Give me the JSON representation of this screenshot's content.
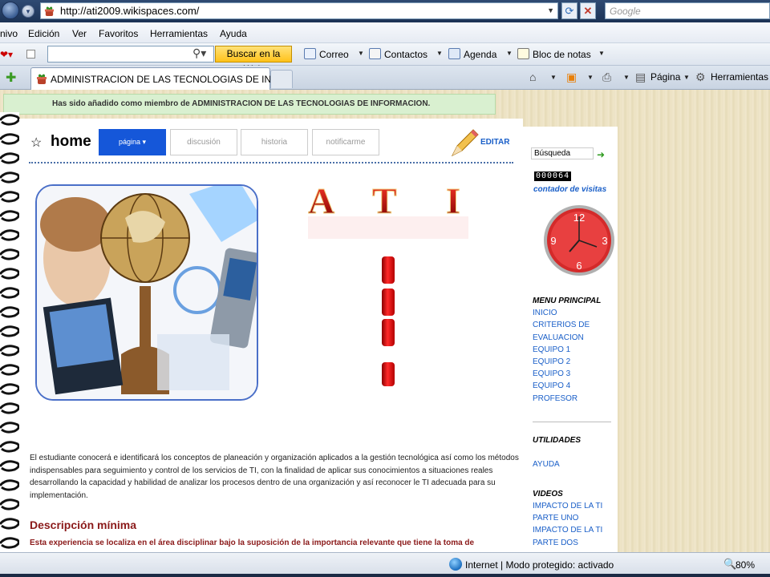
{
  "browser": {
    "url": "http://ati2009.wikispaces.com/",
    "search_placeholder": "Google",
    "menu": [
      "nivo",
      "Edición",
      "Ver",
      "Favoritos",
      "Herramientas",
      "Ayuda"
    ],
    "toolbar": {
      "search_button": "Buscar en la Web",
      "mail": "Correo",
      "contacts": "Contactos",
      "calendar": "Agenda",
      "notepad": "Bloc de notas"
    },
    "tab_title": "ADMINISTRACION DE LAS TECNOLOGIAS DE INF...",
    "commands": {
      "page": "Página",
      "tools": "Herramientas"
    },
    "status": "Internet | Modo protegido: activado",
    "zoom": "80%"
  },
  "notice": "Has sido añadido como miembro de ADMINISTRACION DE LAS TECNOLOGIAS DE INFORMACION.",
  "page": {
    "title": "home",
    "tabs": [
      "página",
      "discusión",
      "historia",
      "notificarme"
    ],
    "edit": "EDITAR",
    "banner_letters": [
      "A",
      "T",
      "I"
    ],
    "intro": "El estudiante conocerá e identificará los conceptos de planeación y organización aplicados a la gestión tecnológica así como los métodos indispensables para seguimiento y control de los servicios de TI, con la finalidad de aplicar sus conocimientos a situaciones reales desarrollando la capacidad y habilidad de analizar los procesos dentro de una organización y así reconocer le TI adecuada para su implementación.",
    "section_heading": "Descripción mínima",
    "section_text": "Esta experiencia se localiza en el área disciplinar bajo la suposición de la importancia relevante que tiene la toma de"
  },
  "sidebar": {
    "search_value": "Búsqueda",
    "counter": "000064",
    "counter_label": "contador de visitas",
    "clock_numbers": [
      "12",
      "3",
      "6",
      "9"
    ],
    "menu_heading": "MENU PRINCIPAL",
    "menu_links": [
      "INICIO",
      "CRITERIOS DE",
      "EVALUACION",
      "EQUIPO 1",
      "EQUIPO 2",
      "EQUIPO 3",
      "EQUIPO 4",
      "PROFESOR"
    ],
    "utilities_heading": "UTILIDADES",
    "utilities_links": [
      "AYUDA"
    ],
    "videos_heading": "VIDEOS",
    "video_links": [
      "IMPACTO DE LA TI",
      "PARTE UNO",
      "IMPACTO DE LA TI",
      "PARTE DOS"
    ]
  }
}
